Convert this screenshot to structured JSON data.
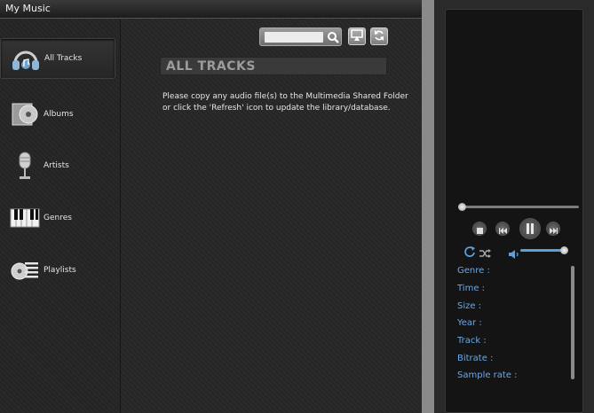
{
  "window": {
    "title": "My Music"
  },
  "sidebar": {
    "items": [
      {
        "label": "All Tracks",
        "icon": "headphones-icon",
        "active": true
      },
      {
        "label": "Albums",
        "icon": "album-icon",
        "active": false
      },
      {
        "label": "Artists",
        "icon": "microphone-icon",
        "active": false
      },
      {
        "label": "Genres",
        "icon": "piano-icon",
        "active": false
      },
      {
        "label": "Playlists",
        "icon": "playlist-icon",
        "active": false
      }
    ]
  },
  "toolbar": {
    "search_value": "",
    "search_icon": "search-icon",
    "airplay_icon": "airplay-icon",
    "refresh_icon": "refresh-icon"
  },
  "main": {
    "section_title": "ALL TRACKS",
    "message": "Please copy any audio file(s) to the Multimedia Shared Folder or click the 'Refresh' icon to update the library/database."
  },
  "player": {
    "progress_fraction": 0.03,
    "volume_fraction": 0.95,
    "info_labels": [
      "Genre :",
      "Time :",
      "Size :",
      "Year :",
      "Track :",
      "Bitrate :",
      "Sample rate :"
    ],
    "accent_color": "#5aa0e0"
  }
}
